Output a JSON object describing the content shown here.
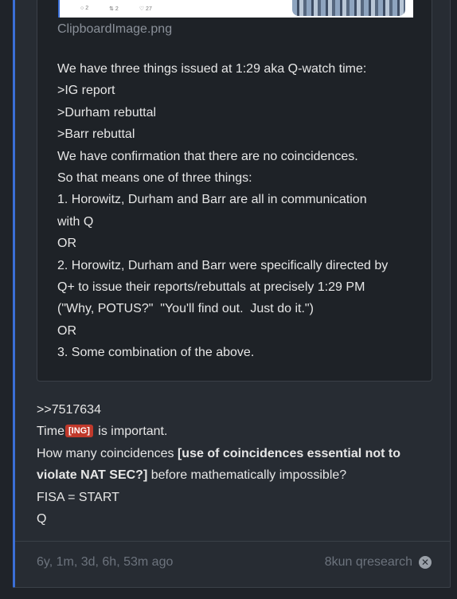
{
  "attachment": {
    "filename": "ClipboardImage.png",
    "thumb_stats": [
      "2",
      "2",
      "27"
    ]
  },
  "quote": {
    "lines": [
      "We have three things issued at 1:29 aka Q-watch time:",
      ">IG report",
      ">Durham rebuttal",
      ">Barr rebuttal",
      "We have confirmation that there are no coincidences.",
      "So that means one of three things:",
      "1. Horowitz, Durham and Barr are all in communication",
      "with Q",
      "OR",
      "2. Horowitz, Durham and Barr were specifically directed by",
      "Q+ to issue their reports/rebuttals at precisely 1:29 PM",
      "(\"Why, POTUS?\"  \"You'll find out.  Just do it.\")",
      "OR",
      "3. Some combination of the above."
    ]
  },
  "post": {
    "reply_link": ">>7517634",
    "time_prefix": "Time",
    "ing_badge": "[ING]",
    "time_suffix": " is important.",
    "line3_prefix": "How many coincidences ",
    "line3_bold": "[use of coincidences essential not to",
    "line4_bold": "violate NAT SEC?]",
    "line4_suffix": " before mathematically impossible?",
    "fisa": "FISA = START",
    "signature": "Q"
  },
  "footer": {
    "timestamp": "6y, 1m, 3d, 6h, 53m ago",
    "source": "8kun qresearch",
    "close_icon": "close-circle-icon"
  },
  "colors": {
    "accent": "#3b6fd6",
    "badge": "#c0392b",
    "background": "#1f2329",
    "card": "#272c33"
  }
}
